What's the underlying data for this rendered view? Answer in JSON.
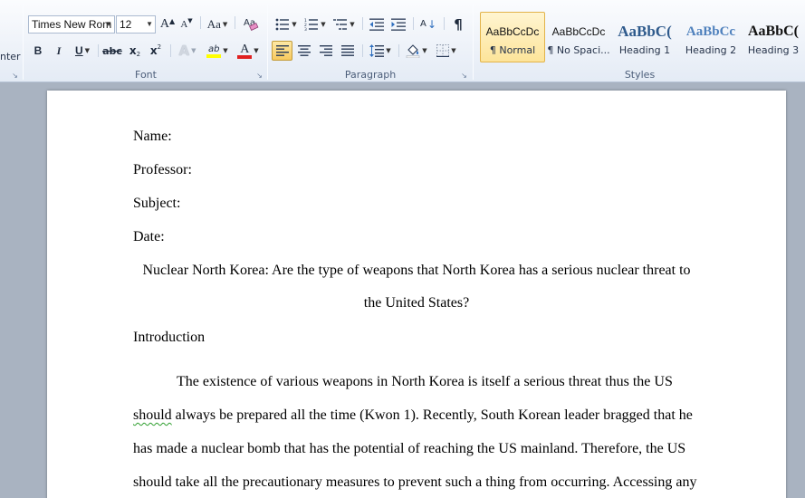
{
  "ribbon": {
    "left_fragment": "nter",
    "font": {
      "label": "Font",
      "font_name": "Times New Rom",
      "font_size": "12",
      "grow_label": "A",
      "shrink_label": "A",
      "case_label": "Aa",
      "bold": "B",
      "italic": "I",
      "underline": "U",
      "strike": "abc",
      "subscript": "x",
      "superscript": "x",
      "text_effects": "A",
      "highlight": "ab",
      "font_color": "A",
      "font_color_hex": "#e02020",
      "highlight_hex": "#ffff00"
    },
    "paragraph": {
      "label": "Paragraph",
      "show_marks": "¶",
      "sort": "A"
    },
    "styles": {
      "label": "Styles",
      "items": [
        {
          "sample": "AaBbCcDc",
          "name": "¶ Normal"
        },
        {
          "sample": "AaBbCcDc",
          "name": "¶ No Spaci..."
        },
        {
          "sample": "AaBbC(",
          "name": "Heading 1"
        },
        {
          "sample": "AaBbCc",
          "name": "Heading 2"
        },
        {
          "sample": "AaBbC(",
          "name": "Heading 3"
        }
      ]
    }
  },
  "document": {
    "lines": {
      "name": "Name:",
      "professor": "Professor:",
      "subject": "Subject:",
      "date": "Date:",
      "title_1": "Nuclear North Korea: Are the type of weapons that North Korea has a serious nuclear threat to",
      "title_2": "the United States?",
      "heading": "Introduction",
      "p1_l1": "The existence of various weapons in North Korea is itself a serious threat thus the US",
      "p1_l2_word": "should",
      "p1_l2_rest": " always be prepared all the time (Kwon 1). Recently, South Korean leader bragged that he",
      "p1_l3": "has made a nuclear bomb that has the potential of reaching the US mainland. Therefore, the US",
      "p1_l4": "should take all the precautionary measures to prevent such a thing from occurring.  Accessing any"
    }
  }
}
